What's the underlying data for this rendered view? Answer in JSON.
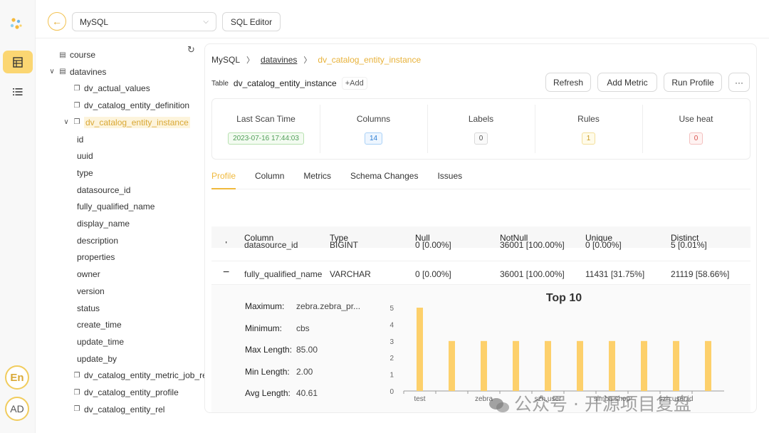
{
  "topbar": {
    "source_select": "MySQL",
    "sql_editor_label": "SQL Editor"
  },
  "rail": {
    "lang_label": "En",
    "avatar_label": "AD"
  },
  "tree": {
    "items": [
      {
        "label": "course",
        "type": "table",
        "level": 0
      },
      {
        "label": "datavines",
        "type": "database",
        "level": 0,
        "expanded": true
      },
      {
        "label": "dv_actual_values",
        "type": "table",
        "level": 1
      },
      {
        "label": "dv_catalog_entity_definition",
        "type": "table",
        "level": 1
      },
      {
        "label": "dv_catalog_entity_instance",
        "type": "table",
        "level": 1,
        "expanded": true,
        "selected": true
      },
      {
        "label": "id",
        "type": "column",
        "level": 2
      },
      {
        "label": "uuid",
        "type": "column",
        "level": 2
      },
      {
        "label": "type",
        "type": "column",
        "level": 2
      },
      {
        "label": "datasource_id",
        "type": "column",
        "level": 2
      },
      {
        "label": "fully_qualified_name",
        "type": "column",
        "level": 2
      },
      {
        "label": "display_name",
        "type": "column",
        "level": 2
      },
      {
        "label": "description",
        "type": "column",
        "level": 2
      },
      {
        "label": "properties",
        "type": "column",
        "level": 2
      },
      {
        "label": "owner",
        "type": "column",
        "level": 2
      },
      {
        "label": "version",
        "type": "column",
        "level": 2
      },
      {
        "label": "status",
        "type": "column",
        "level": 2
      },
      {
        "label": "create_time",
        "type": "column",
        "level": 2
      },
      {
        "label": "update_time",
        "type": "column",
        "level": 2
      },
      {
        "label": "update_by",
        "type": "column",
        "level": 2
      },
      {
        "label": "dv_catalog_entity_metric_job_rel",
        "type": "table",
        "level": 1
      },
      {
        "label": "dv_catalog_entity_profile",
        "type": "table",
        "level": 1
      },
      {
        "label": "dv_catalog_entity_rel",
        "type": "table",
        "level": 1
      }
    ]
  },
  "breadcrumb": {
    "root": "MySQL",
    "database": "datavines",
    "table": "dv_catalog_entity_instance"
  },
  "table_info": {
    "tag": "Table",
    "name": "dv_catalog_entity_instance",
    "add_label": "+Add"
  },
  "actions": {
    "refresh": "Refresh",
    "add_metric": "Add Metric",
    "run_profile": "Run Profile",
    "more": "···"
  },
  "stats": [
    {
      "label": "Last Scan Time",
      "value": "2023-07-16 17:44:03",
      "color": "green"
    },
    {
      "label": "Columns",
      "value": "14",
      "color": "blue"
    },
    {
      "label": "Labels",
      "value": "0",
      "color": "gray"
    },
    {
      "label": "Rules",
      "value": "1",
      "color": "yellow"
    },
    {
      "label": "Use heat",
      "value": "0",
      "color": "red"
    }
  ],
  "tabs": [
    "Profile",
    "Column",
    "Metrics",
    "Schema Changes",
    "Issues"
  ],
  "active_tab": "Profile",
  "profile_table": {
    "headers": [
      "Column",
      "Type",
      "Null",
      "NotNull",
      "Unique",
      "Distinct"
    ],
    "rows": [
      {
        "toggle": "+",
        "column": "datasource_id",
        "type": "BIGINT",
        "null": "0 [0.00%]",
        "notnull": "36001 [100.00%]",
        "unique": "0 [0.00%]",
        "distinct": "5 [0.01%]"
      },
      {
        "toggle": "−",
        "column": "fully_qualified_name",
        "type": "VARCHAR",
        "null": "0 [0.00%]",
        "notnull": "36001 [100.00%]",
        "unique": "11431 [31.75%]",
        "distinct": "21119 [58.66%]"
      }
    ]
  },
  "detail": {
    "stats": [
      {
        "key": "Maximum:",
        "value": "zebra.zebra_pr..."
      },
      {
        "key": "Minimum:",
        "value": "cbs"
      },
      {
        "key": "Max Length:",
        "value": "85.00"
      },
      {
        "key": "Min Length:",
        "value": "2.00"
      },
      {
        "key": "Avg Length:",
        "value": "40.61"
      }
    ]
  },
  "chart_data": {
    "type": "bar",
    "title": "Top 10",
    "categories": [
      "test",
      "",
      "zebra",
      "",
      "szh.user",
      "",
      "simba.shop",
      "",
      "szh.user.id",
      ""
    ],
    "values": [
      5,
      3,
      3,
      3,
      3,
      3,
      3,
      3,
      3,
      3
    ],
    "ylim": [
      0,
      5
    ],
    "yticks": [
      0,
      1,
      2,
      3,
      4,
      5
    ],
    "bar_color": "#fdd06b"
  },
  "watermark": "公众号 · 开源项目复盘",
  "colors": {
    "accent": "#f0b93d",
    "rail_active": "#fbd672"
  }
}
